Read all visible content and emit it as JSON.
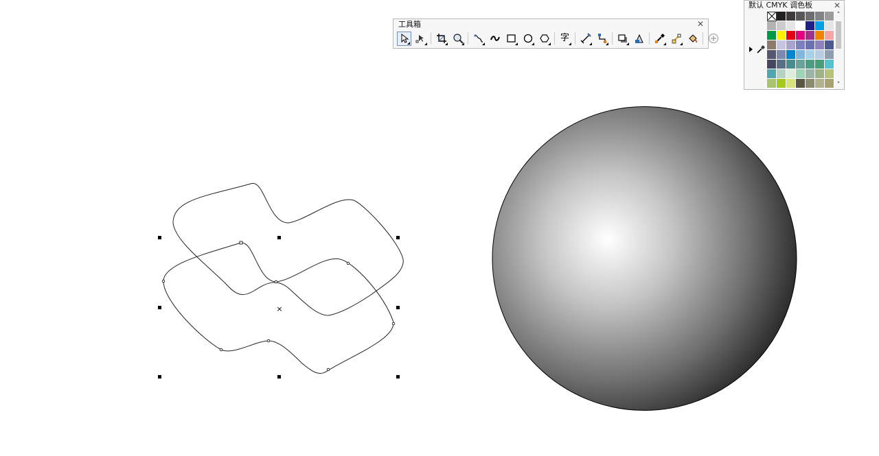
{
  "toolbox": {
    "title": "工具箱",
    "close": "✕",
    "tools": [
      {
        "name": "pick-tool",
        "icon": "pointer-icon",
        "active": true
      },
      {
        "name": "shape-tool",
        "icon": "shape-node-icon"
      },
      {
        "name": "crop-tool",
        "icon": "crop-icon"
      },
      {
        "name": "zoom-tool",
        "icon": "zoom-icon"
      },
      {
        "name": "freehand-tool",
        "icon": "freehand-icon"
      },
      {
        "name": "artistic-media-tool",
        "icon": "artistic-media-icon"
      },
      {
        "name": "rectangle-tool",
        "icon": "rectangle-icon"
      },
      {
        "name": "ellipse-tool",
        "icon": "ellipse-icon"
      },
      {
        "name": "polygon-tool",
        "icon": "polygon-icon"
      },
      {
        "name": "text-tool",
        "icon": "text-icon",
        "glyph": "字"
      },
      {
        "name": "parallel-dimension-tool",
        "icon": "dimension-icon"
      },
      {
        "name": "connector-tool",
        "icon": "connector-icon"
      },
      {
        "name": "drop-shadow-tool",
        "icon": "drop-shadow-icon"
      },
      {
        "name": "transparency-tool",
        "icon": "transparency-icon"
      },
      {
        "name": "color-eyedropper-tool",
        "icon": "eyedropper-icon"
      },
      {
        "name": "interactive-fill-tool",
        "icon": "fill-icon"
      },
      {
        "name": "smart-fill-tool",
        "icon": "smart-fill-icon"
      },
      {
        "name": "add-tool",
        "icon": "plus-circle-icon"
      }
    ]
  },
  "palette": {
    "title": "默认 CMYK 调色板",
    "close": "✕",
    "scroll_up": "˄",
    "scroll_down": "˅",
    "colors": [
      "none",
      "#231f20",
      "#3d3a3b",
      "#58585a",
      "#6d6e70",
      "#828386",
      "#9c9c9f",
      "#b3b3b5",
      "#cbcbcc",
      "#e5e5e6",
      "#ffffff",
      "#1d2087",
      "#00a0e9",
      "#e5e5e6",
      "#009944",
      "#fff100",
      "#e60012",
      "#e4007f",
      "#a0308b",
      "#f08300",
      "#f5a5a5",
      "#8c7b6b",
      "#c6c3e3",
      "#a7a4d0",
      "#7b7fc0",
      "#6c71b3",
      "#8e82bc",
      "#4c5a91",
      "#535770",
      "#7d8ab0",
      "#0086d1",
      "#7fb8df",
      "#a6d3ea",
      "#b6cde4",
      "#8f9fb3",
      "#43475f",
      "#5a7088",
      "#4a8d8f",
      "#6aa39b",
      "#4b9d83",
      "#489e79",
      "#57c2cf",
      "#53a5b0",
      "#b6d3c1",
      "#dcefdc",
      "#9fd3b5",
      "#9bb3a5",
      "#9eb386",
      "#b6c277",
      "#a9c46f",
      "#a5c81d",
      "#d7e37b",
      "#5a5843",
      "#8c8b6d",
      "#b3b08d",
      "#a9a371"
    ]
  },
  "canvas": {
    "object_center_mark": "×"
  }
}
